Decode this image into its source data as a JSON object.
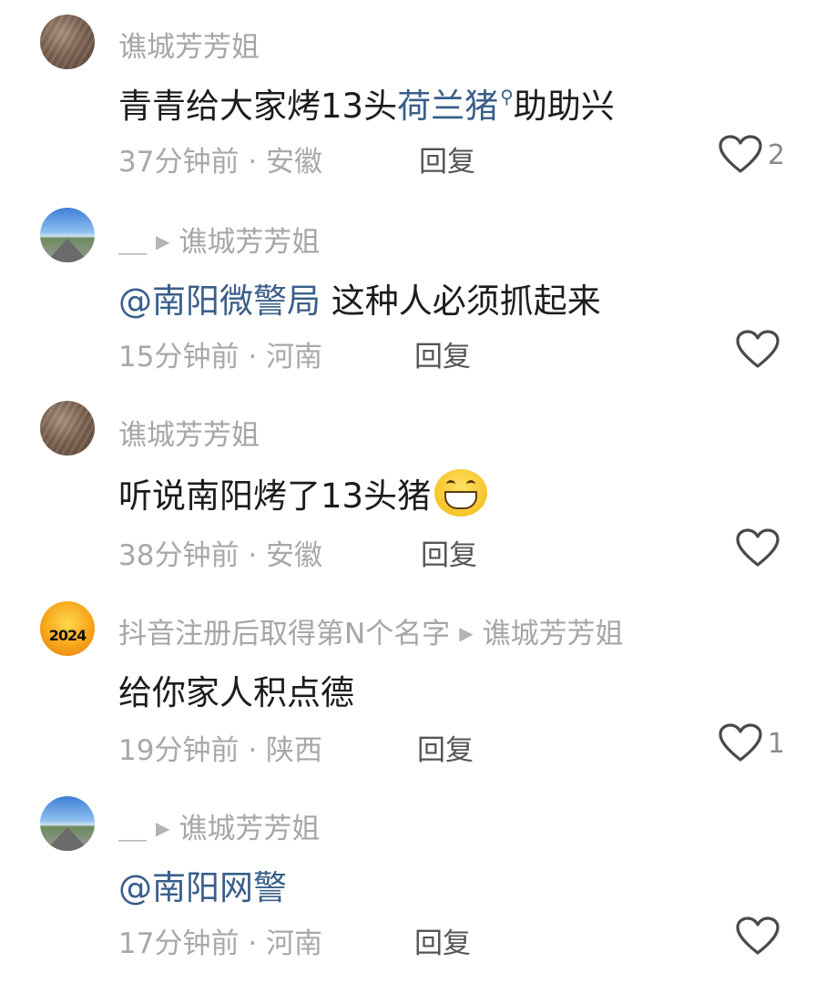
{
  "comments": [
    {
      "author": "谯城芳芳姐",
      "text_parts": [
        "青青给大家烤13头",
        "荷兰猪",
        "助助兴"
      ],
      "time": "37分钟前",
      "location": "安徽",
      "reply_label": "回复",
      "likes": "2"
    },
    {
      "author": "＿",
      "reply_to": "谯城芳芳姐",
      "mention": "@南阳微警局",
      "text": "这种人必须抓起来",
      "time": "15分钟前",
      "location": "河南",
      "reply_label": "回复",
      "likes": ""
    },
    {
      "author": "谯城芳芳姐",
      "text": "听说南阳烤了13头猪",
      "time": "38分钟前",
      "location": "安徽",
      "reply_label": "回复",
      "likes": ""
    },
    {
      "author": "抖音注册后取得第N个名字",
      "avatar_text": "2024",
      "reply_to": "谯城芳芳姐",
      "text": "给你家人积点德",
      "time": "19分钟前",
      "location": "陕西",
      "reply_label": "回复",
      "likes": "1"
    },
    {
      "author": "＿",
      "reply_to": "谯城芳芳姐",
      "mention": "@南阳网警",
      "time": "17分钟前",
      "location": "河南",
      "reply_label": "回复",
      "likes": ""
    }
  ],
  "meta_separator": "·",
  "icons": {
    "like": "heart-outline-icon",
    "reply_arrow": "triangle-right-icon",
    "search": "search-mini-icon",
    "emoji": "grinning-emoji"
  },
  "colors": {
    "link": "#3a5f8a",
    "meta": "#a8a8a8",
    "text": "#1c1c1c"
  }
}
